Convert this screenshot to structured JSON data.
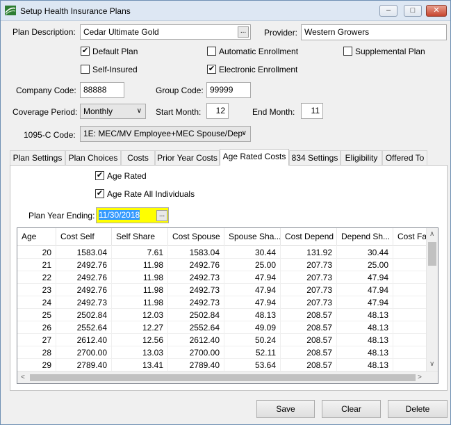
{
  "window": {
    "title": "Setup Health Insurance Plans",
    "minimize_glyph": "–",
    "restore_glyph": "□",
    "close_glyph": "✕"
  },
  "form": {
    "plan_description_label": "Plan Description:",
    "plan_description_value": "Cedar Ultimate Gold",
    "provider_label": "Provider:",
    "provider_value": "Western Growers",
    "ellipsis": "...",
    "check_glyph": "✔",
    "checkboxes": {
      "default_plan": {
        "label": "Default Plan",
        "checked": true
      },
      "automatic_enrollment": {
        "label": "Automatic Enrollment",
        "checked": false
      },
      "supplemental_plan": {
        "label": "Supplemental Plan",
        "checked": false
      },
      "self_insured": {
        "label": "Self-Insured",
        "checked": false
      },
      "electronic_enrollment": {
        "label": "Electronic Enrollment",
        "checked": true
      }
    },
    "company_code_label": "Company Code:",
    "company_code_value": "88888",
    "group_code_label": "Group Code:",
    "group_code_value": "99999",
    "coverage_period_label": "Coverage Period:",
    "coverage_period_value": "Monthly",
    "start_month_label": "Start Month:",
    "start_month_value": "12",
    "end_month_label": "End Month:",
    "end_month_value": "11",
    "code_1095c_label": "1095-C Code:",
    "code_1095c_value": "1E: MEC/MV Employee+MEC Spouse/Dep",
    "dropdown_glyph": "∨"
  },
  "tabs": [
    {
      "label": "Plan Settings"
    },
    {
      "label": "Plan Choices"
    },
    {
      "label": "Costs"
    },
    {
      "label": "Prior Year Costs"
    },
    {
      "label": "Age Rated Costs"
    },
    {
      "label": "834 Settings"
    },
    {
      "label": "Eligibility"
    },
    {
      "label": "Offered To"
    }
  ],
  "active_tab": "Age Rated Costs",
  "age_rated": {
    "age_rated_label": "Age Rated",
    "age_rated_checked": true,
    "age_rate_all_label": "Age Rate All Individuals",
    "age_rate_all_checked": true,
    "plan_year_ending_label": "Plan Year Ending:",
    "plan_year_ending_value": "11/30/2018",
    "highlight_color": "#ffff00"
  },
  "grid": {
    "columns": [
      "Age",
      "Cost Self",
      "Self Share",
      "Cost Spouse",
      "Spouse Sha...",
      "Cost Depend",
      "Depend Sh...",
      "Cost Fa"
    ],
    "rows": [
      [
        "20",
        "1583.04",
        "7.61",
        "1583.04",
        "30.44",
        "131.92",
        "30.44"
      ],
      [
        "21",
        "2492.76",
        "11.98",
        "2492.76",
        "25.00",
        "207.73",
        "25.00"
      ],
      [
        "22",
        "2492.76",
        "11.98",
        "2492.73",
        "47.94",
        "207.73",
        "47.94"
      ],
      [
        "23",
        "2492.76",
        "11.98",
        "2492.73",
        "47.94",
        "207.73",
        "47.94"
      ],
      [
        "24",
        "2492.73",
        "11.98",
        "2492.73",
        "47.94",
        "207.73",
        "47.94"
      ],
      [
        "25",
        "2502.84",
        "12.03",
        "2502.84",
        "48.13",
        "208.57",
        "48.13"
      ],
      [
        "26",
        "2552.64",
        "12.27",
        "2552.64",
        "49.09",
        "208.57",
        "48.13"
      ],
      [
        "27",
        "2612.40",
        "12.56",
        "2612.40",
        "50.24",
        "208.57",
        "48.13"
      ],
      [
        "28",
        "2700.00",
        "13.03",
        "2700.00",
        "52.11",
        "208.57",
        "48.13"
      ],
      [
        "29",
        "2789.40",
        "13.41",
        "2789.40",
        "53.64",
        "208.57",
        "48.13"
      ]
    ],
    "arrows": {
      "up": "∧",
      "down": "∨",
      "left": "<",
      "right": ">"
    }
  },
  "buttons": {
    "save": "Save",
    "clear": "Clear",
    "delete": "Delete"
  }
}
